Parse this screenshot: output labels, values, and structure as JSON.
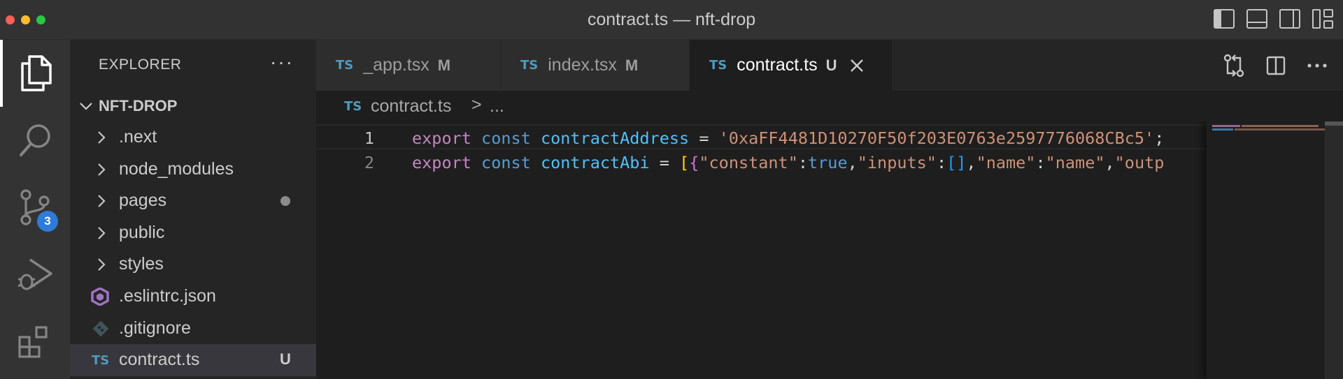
{
  "window": {
    "title": "contract.ts — nft-drop"
  },
  "activity_bar": {
    "items": [
      {
        "name": "explorer",
        "icon": "files-icon"
      },
      {
        "name": "search",
        "icon": "search-icon"
      },
      {
        "name": "source-control",
        "icon": "source-control-icon",
        "badge": "3"
      },
      {
        "name": "run-debug",
        "icon": "run-debug-icon"
      },
      {
        "name": "extensions",
        "icon": "extensions-icon"
      }
    ]
  },
  "sidebar": {
    "title": "EXPLORER",
    "more": "···",
    "folder": "NFT-DROP",
    "items": [
      {
        "label": ".next",
        "type": "folder"
      },
      {
        "label": "node_modules",
        "type": "folder"
      },
      {
        "label": "pages",
        "type": "folder",
        "modified_dot": true
      },
      {
        "label": "public",
        "type": "folder"
      },
      {
        "label": "styles",
        "type": "folder"
      },
      {
        "label": ".eslintrc.json",
        "type": "file",
        "icon": "eslint-icon"
      },
      {
        "label": ".gitignore",
        "type": "file",
        "icon": "git-icon"
      },
      {
        "label": "contract.ts",
        "type": "file",
        "icon": "typescript-icon",
        "status": "U",
        "selected": true
      }
    ]
  },
  "tabs": [
    {
      "file_type": "TS",
      "label": "_app.tsx",
      "status": "M"
    },
    {
      "file_type": "TS",
      "label": "index.tsx",
      "status": "M"
    },
    {
      "file_type": "TS",
      "label": "contract.ts",
      "status": "U",
      "active": true
    }
  ],
  "breadcrumb": {
    "file_type": "TS",
    "file": "contract.ts",
    "separator": ">",
    "more": "..."
  },
  "editor": {
    "lines": [
      {
        "number": "1",
        "tokens": {
          "t1": "export",
          "t2": "const",
          "t3": "contractAddress",
          "t4": "=",
          "t5": "'0xaFF4481D10270F50f203E0763e2597776068CBc5'",
          "t6": ";"
        }
      },
      {
        "number": "2",
        "tokens": {
          "t1": "export",
          "t2": "const",
          "t3": "contractAbi",
          "t4": "=",
          "b1": "[",
          "b2": "{",
          "s1": "\"constant\"",
          "c1": ":",
          "v1": "true",
          "c2": ",",
          "s2": "\"inputs\"",
          "c3": ":",
          "b3": "[]",
          "c4": ",",
          "s3": "\"name\"",
          "c5": ":",
          "s4": "\"name\"",
          "c6": ",",
          "s5": "\"outp"
        }
      }
    ]
  },
  "colors": {
    "keyword": "#c586c0",
    "storage": "#569cd6",
    "variable": "#4fc1ff",
    "string": "#ce9178",
    "badge": "#2f7bd8",
    "typescript": "#519aba"
  }
}
